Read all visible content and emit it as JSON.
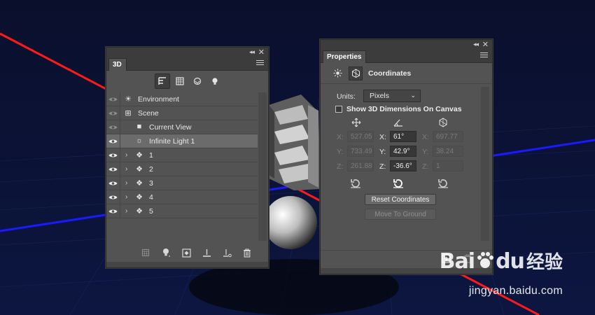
{
  "panel_3d": {
    "tab_label": "3D",
    "collapse_glyph": "◂◂",
    "close_glyph": "✕",
    "filters": [
      {
        "name": "whole-scene-filter",
        "icon": "scene-tree-icon",
        "glyph": "⊞",
        "active": true
      },
      {
        "name": "meshes-filter",
        "icon": "mesh-icon",
        "glyph": "▦",
        "active": false
      },
      {
        "name": "materials-filter",
        "icon": "material-icon",
        "glyph": "◈",
        "active": false
      },
      {
        "name": "lights-filter",
        "icon": "light-bulb-icon",
        "glyph": "●",
        "active": false
      }
    ],
    "layers": [
      {
        "label": "Environment",
        "icon": "environment-icon",
        "glyph": "☀",
        "level": 0,
        "twist": false,
        "selected": false,
        "eye": "dim"
      },
      {
        "label": "Scene",
        "icon": "scene-icon",
        "glyph": "⊞",
        "level": 0,
        "twist": false,
        "selected": false,
        "eye": "dim"
      },
      {
        "label": "Current View",
        "icon": "camera-icon",
        "glyph": "■",
        "level": 1,
        "twist": false,
        "selected": false,
        "eye": "dim"
      },
      {
        "label": "Infinite Light 1",
        "icon": "infinite-light-icon",
        "glyph": "☼",
        "level": 1,
        "twist": false,
        "selected": true,
        "eye": "on"
      },
      {
        "label": "1",
        "icon": "mesh-icon",
        "glyph": "❖",
        "level": 1,
        "twist": true,
        "selected": false,
        "eye": "on"
      },
      {
        "label": "2",
        "icon": "mesh-icon",
        "glyph": "❖",
        "level": 1,
        "twist": true,
        "selected": false,
        "eye": "on"
      },
      {
        "label": "3",
        "icon": "mesh-icon",
        "glyph": "❖",
        "level": 1,
        "twist": true,
        "selected": false,
        "eye": "on"
      },
      {
        "label": "4",
        "icon": "mesh-icon",
        "glyph": "❖",
        "level": 1,
        "twist": true,
        "selected": false,
        "eye": "on"
      },
      {
        "label": "5",
        "icon": "mesh-icon",
        "glyph": "❖",
        "level": 1,
        "twist": true,
        "selected": false,
        "eye": "on"
      }
    ],
    "bottom_icons": [
      "new-mesh-icon",
      "add-light-icon",
      "render-icon",
      "ground-plane-icon",
      "shadow-catcher-icon",
      "trash-icon"
    ]
  },
  "panel_properties": {
    "tab_label": "Properties",
    "section_title": "Coordinates",
    "units_label": "Units:",
    "units_value": "Pixels",
    "show_dims_label": "Show 3D Dimensions On Canvas",
    "show_dims_checked": false,
    "position": {
      "x_label": "X:",
      "y_label": "Y:",
      "z_label": "Z:",
      "x": "527.05",
      "y": "733.49",
      "z": "261.88"
    },
    "rotation": {
      "x_label": "X:",
      "y_label": "Y:",
      "z_label": "Z:",
      "x": "61°",
      "y": "42.9°",
      "z": "-36.6°"
    },
    "scale": {
      "x_label": "X:",
      "y_label": "Y:",
      "z_label": "Z:",
      "x": "697.77",
      "y": "38.24",
      "z": "1"
    },
    "reset_coordinates_label": "Reset Coordinates",
    "move_to_ground_label": "Move To Ground"
  },
  "watermark": {
    "logo_text": "Bai",
    "logo_text2": "du",
    "chinese": "经验",
    "url": "jingyan.baidu.com"
  },
  "colors": {
    "panel_bg": "#535353",
    "panel_dark": "#3c3c3c",
    "canvas_bg": "#0b1030",
    "x_axis": "#ff1a1a",
    "z_axis": "#1a1aff"
  }
}
